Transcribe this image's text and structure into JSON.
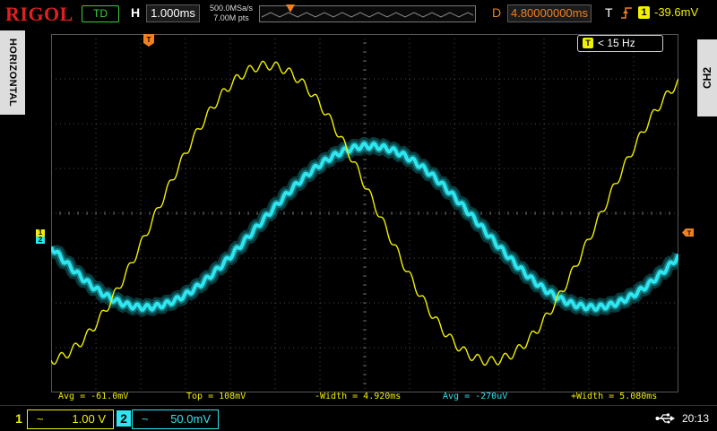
{
  "brand": "RIGOL",
  "top": {
    "run_state": "TD",
    "h_label": "H",
    "timebase": "1.000ms",
    "sample_rate": "500.0MSa/s",
    "memory_depth": "7.00M pts",
    "d_label": "D",
    "delay": "4.80000000ms",
    "t_label": "T",
    "trigger_source": "1",
    "trigger_level": "-39.6mV"
  },
  "side": {
    "left_tab": "HORIZONTAL",
    "right_tab": "CH2"
  },
  "screen": {
    "trigger_freq_label": "< 15 Hz",
    "trigger_freq_icon": "T",
    "ch1_marker": "1",
    "ch2_marker": "2"
  },
  "measurements": [
    {
      "label": "Avg = -61.0mV",
      "channel": 1
    },
    {
      "label": "Top = 108mV",
      "channel": 1
    },
    {
      "label": "-Width = 4.920ms",
      "channel": 1
    },
    {
      "label": "Avg = -270uV",
      "channel": 2
    },
    {
      "label": "+Width = 5.080ms",
      "channel": 1
    }
  ],
  "bottom": {
    "ch1": {
      "number": "1",
      "coupling": "~",
      "scale": "1.00 V"
    },
    "ch2": {
      "number": "2",
      "coupling": "~",
      "scale": "50.0mV"
    },
    "clock": "20:13"
  },
  "colors": {
    "ch1": "#f0f000",
    "ch2": "#2ee6f0",
    "trigger": "#f08020",
    "brand": "#e02020"
  }
}
